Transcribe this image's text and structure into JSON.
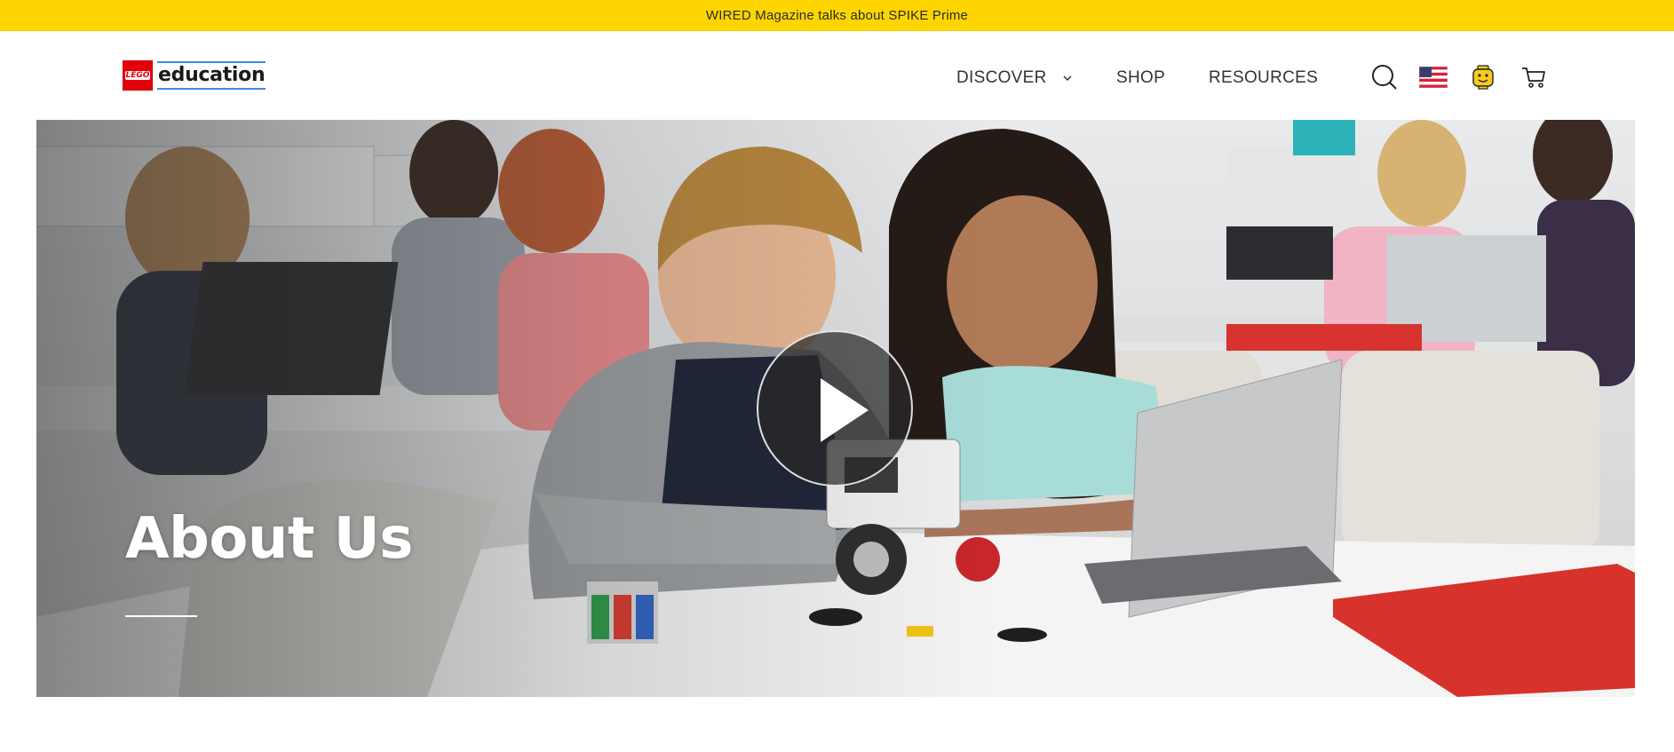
{
  "announcement": {
    "text": "WIRED Magazine talks about SPIKE Prime"
  },
  "header": {
    "logo": {
      "brick_text": "LEGO",
      "word": "education"
    },
    "nav": [
      {
        "label": "DISCOVER",
        "has_dropdown": true
      },
      {
        "label": "SHOP"
      },
      {
        "label": "RESOURCES"
      }
    ],
    "icons": [
      "search-icon",
      "us-flag-icon",
      "minifig-face-icon",
      "cart-icon"
    ]
  },
  "hero": {
    "title": "About Us",
    "video_control": "play-icon"
  },
  "colors": {
    "announcement_bg": "#FFD500",
    "logo_red": "#E3000B",
    "logo_blue": "#3A8DDE",
    "nav_text": "#333333",
    "minifig_yellow": "#F6CB1E"
  }
}
